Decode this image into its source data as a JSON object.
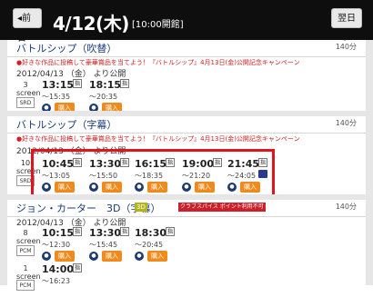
{
  "header": {
    "prev_label": "◂前日",
    "date": "4/12(木)",
    "opening": "[10:00開館]",
    "next_label": "翌日▸"
  },
  "movies": [
    {
      "title": "バトルシップ（吹替）",
      "duration": "140分",
      "promo_prefix": "●好きな作品に投稿して豪華賞品を当てよう！『バトルシップ』4月13日(金)公開記念キャンペーン",
      "release": "2012/04/13 （金） より公開",
      "screen": "3",
      "screen_word": "screen",
      "format": "SRD",
      "shows": [
        {
          "start": "13:15",
          "end": "～15:35",
          "flag": "指",
          "buy": "購入"
        },
        {
          "start": "18:15",
          "end": "～20:35",
          "flag": "指",
          "buy": "購入"
        }
      ]
    },
    {
      "title": "バトルシップ（字幕）",
      "duration": "140分",
      "promo_prefix": "●好きな作品に投稿して豪華賞品を当てよう！『バトルシップ』4月13日(金)公開記念キャンペーン",
      "release": "2012/04/13 （金） より公開",
      "screen": "10",
      "screen_word": "screen",
      "format": "SRD",
      "shows": [
        {
          "start": "10:45",
          "end": "～13:05",
          "flag": "指",
          "buy": "購入"
        },
        {
          "start": "13:30",
          "end": "～15:50",
          "flag": "指",
          "buy": "購入"
        },
        {
          "start": "16:15",
          "end": "～18:35",
          "flag": "指",
          "buy": "購入"
        },
        {
          "start": "19:00",
          "end": "～21:20",
          "flag": "指",
          "buy": "購入"
        },
        {
          "start": "21:45",
          "end": "～24:05",
          "flag": "指",
          "buy": "購入"
        }
      ]
    },
    {
      "title": "ジョン・カーター　3D（字幕）",
      "duration": "140分",
      "badge1": "3D",
      "badge2": "クラブスパイス ポイント利用不可",
      "release": "2012/04/13 （金） より公開",
      "screen": "8",
      "screen_word": "screen",
      "format": "PCM",
      "shows": [
        {
          "start": "10:15",
          "end": "～12:30",
          "flag": "指",
          "buy": "購入"
        },
        {
          "start": "13:30",
          "end": "～15:45",
          "flag": "指",
          "buy": "購入"
        },
        {
          "start": "18:30",
          "end": "～20:45",
          "flag": "指",
          "buy": "購入"
        }
      ]
    },
    {
      "screen": "1",
      "screen_word": "screen",
      "format": "PCM",
      "shows": [
        {
          "start": "14:00",
          "end": "～16:23",
          "flag": "指",
          "buy": "購入"
        }
      ]
    }
  ],
  "colors": {
    "accent_red": "#e0141a",
    "buy_orange": "#f08a1d",
    "title_blue": "#1a3c7a",
    "topbar": "#0e0e0e"
  }
}
